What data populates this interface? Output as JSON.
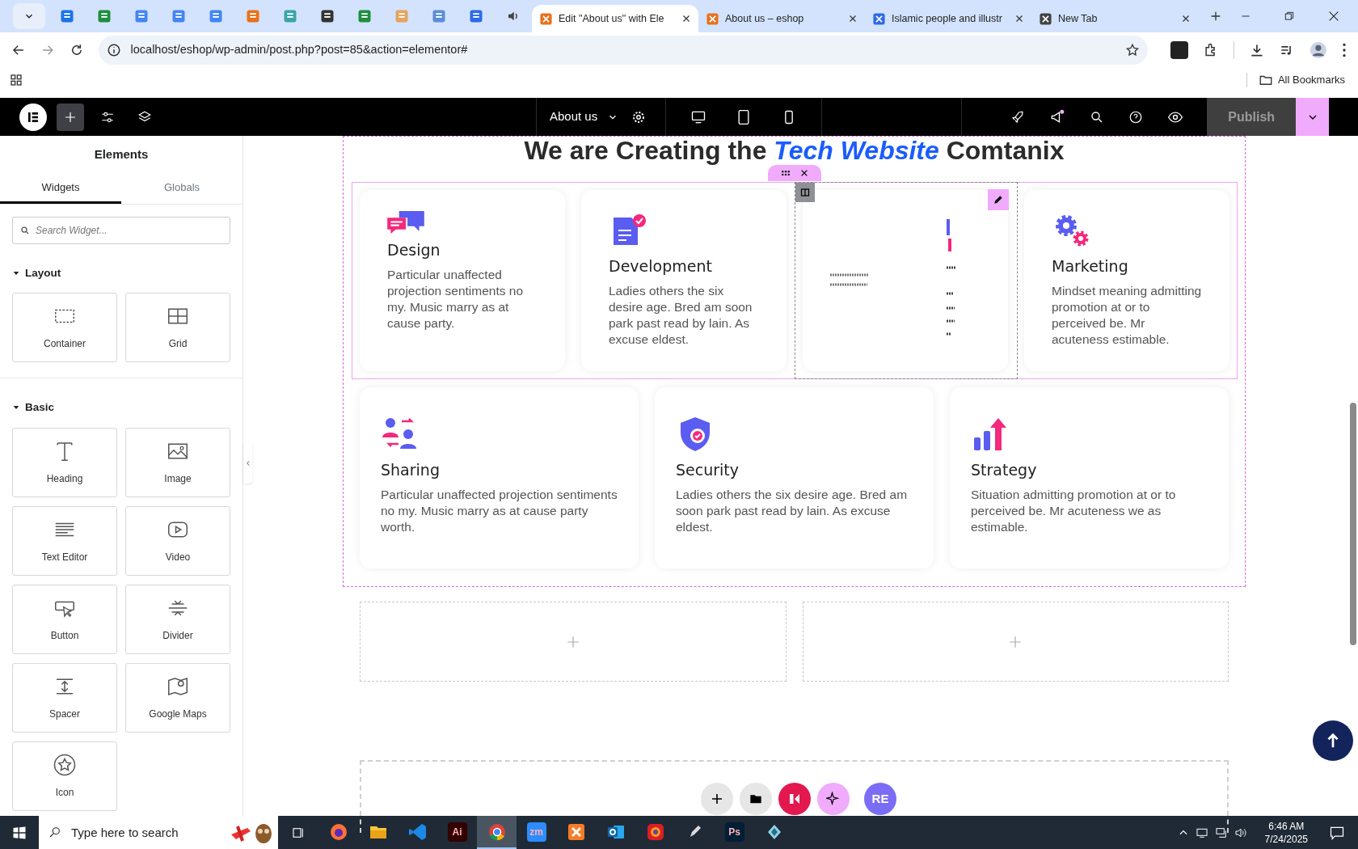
{
  "browser": {
    "tabs": [
      {
        "kind": "icon",
        "color": "#1a73e8",
        "selected": false
      },
      {
        "kind": "icon",
        "color": "#1e8e3e",
        "selected": false
      },
      {
        "kind": "icon",
        "color": "#4285f4",
        "selected": false
      },
      {
        "kind": "icon",
        "color": "#4285f4",
        "selected": false
      },
      {
        "kind": "icon",
        "color": "#4285f4",
        "selected": false
      },
      {
        "kind": "icon",
        "color": "#e8711c",
        "selected": false
      },
      {
        "kind": "icon",
        "color": "#3aa5a8",
        "selected": false
      },
      {
        "kind": "icon",
        "color": "#333333",
        "selected": false
      },
      {
        "kind": "icon",
        "color": "#1e8e3e",
        "selected": false
      },
      {
        "kind": "icon",
        "color": "#e8a25c",
        "selected": false
      },
      {
        "kind": "icon",
        "color": "#5b8dd6",
        "selected": false
      },
      {
        "kind": "icon",
        "color": "#2d6ae8",
        "selected": false
      },
      {
        "kind": "audio",
        "color": "#444444",
        "selected": false
      },
      {
        "kind": "page",
        "label": "Edit \"About us\" with Ele",
        "color": "#e8711c",
        "selected": true
      },
      {
        "kind": "page",
        "label": "About us – eshop",
        "color": "#e8711c",
        "selected": false
      },
      {
        "kind": "page",
        "label": "Islamic people and illustr",
        "color": "#2d6ae8",
        "selected": false
      },
      {
        "kind": "page",
        "label": "New Tab",
        "color": "#444444",
        "selected": false
      }
    ],
    "url": "localhost/eshop/wp-admin/post.php?post=85&action=elementor#",
    "bookmarks": "All Bookmarks"
  },
  "editor": {
    "page_title": "About us",
    "publish": "Publish"
  },
  "sidebar": {
    "title": "Elements",
    "tabs": [
      {
        "label": "Widgets",
        "selected": true
      },
      {
        "label": "Globals",
        "selected": false
      }
    ],
    "search": {
      "placeholder": "Search Widget..."
    },
    "sections": [
      {
        "title": "Layout",
        "expanded": true,
        "widgets": [
          {
            "label": "Container",
            "kind": "container"
          },
          {
            "label": "Grid",
            "kind": "grid"
          }
        ]
      },
      {
        "title": "Basic",
        "expanded": true,
        "widgets": [
          {
            "label": "Heading",
            "kind": "heading"
          },
          {
            "label": "Image",
            "kind": "image"
          },
          {
            "label": "Text Editor",
            "kind": "text"
          },
          {
            "label": "Video",
            "kind": "video"
          },
          {
            "label": "Button",
            "kind": "button"
          },
          {
            "label": "Divider",
            "kind": "divider"
          },
          {
            "label": "Spacer",
            "kind": "spacer"
          },
          {
            "label": "Google Maps",
            "kind": "map"
          },
          {
            "label": "Icon",
            "kind": "star"
          }
        ]
      }
    ]
  },
  "canvas": {
    "heading": {
      "before": "We are Creating the",
      "highlight": "Tech Website",
      "after": "Comtanix"
    },
    "rows": [
      [
        {
          "kind": "card",
          "title": "Design",
          "text": "Particular unaffected projection sentiments no my. Music marry as at cause party."
        },
        {
          "kind": "card",
          "title": "Development",
          "text": "Ladies others the six desire age. Bred am soon park past read by lain. As excuse eldest."
        },
        {
          "kind": "flipping"
        },
        {
          "kind": "card",
          "title": "Marketing",
          "text": "Mindset meaning admitting promotion at or to perceived be. Mr acuteness estimable."
        }
      ],
      [
        {
          "kind": "card",
          "title": "Sharing",
          "text": "Particular unaffected projection sentiments no my. Music marry as at cause party worth."
        },
        {
          "kind": "card",
          "title": "Security",
          "text": "Ladies others the six desire age. Bred am soon park past read by lain. As excuse eldest."
        },
        {
          "kind": "card",
          "title": "Strategy",
          "text": "Situation admitting promotion at or to perceived be. Mr acuteness we as estimable."
        }
      ]
    ],
    "floating_logo": "RE"
  },
  "taskbar": {
    "search": {
      "placeholder": "Type here to search"
    },
    "apps": [
      {
        "kind": "firefox",
        "selected": false
      },
      {
        "kind": "folder",
        "selected": false
      },
      {
        "kind": "vscode",
        "selected": false
      },
      {
        "kind": "badge",
        "label": "Ai",
        "color": "#330000",
        "selected": false
      },
      {
        "kind": "chrome",
        "selected": true
      },
      {
        "kind": "badge",
        "label": "zm",
        "color": "#2d8cff",
        "selected": false
      },
      {
        "kind": "xampp",
        "selected": false
      },
      {
        "kind": "outlook",
        "selected": false
      },
      {
        "kind": "cloud",
        "selected": false
      },
      {
        "kind": "pen",
        "selected": false
      },
      {
        "kind": "badge",
        "label": "Ps",
        "color": "#001e36",
        "selected": false
      },
      {
        "kind": "gem",
        "selected": false
      }
    ],
    "time": "6:46 AM",
    "date": "7/24/2025"
  }
}
